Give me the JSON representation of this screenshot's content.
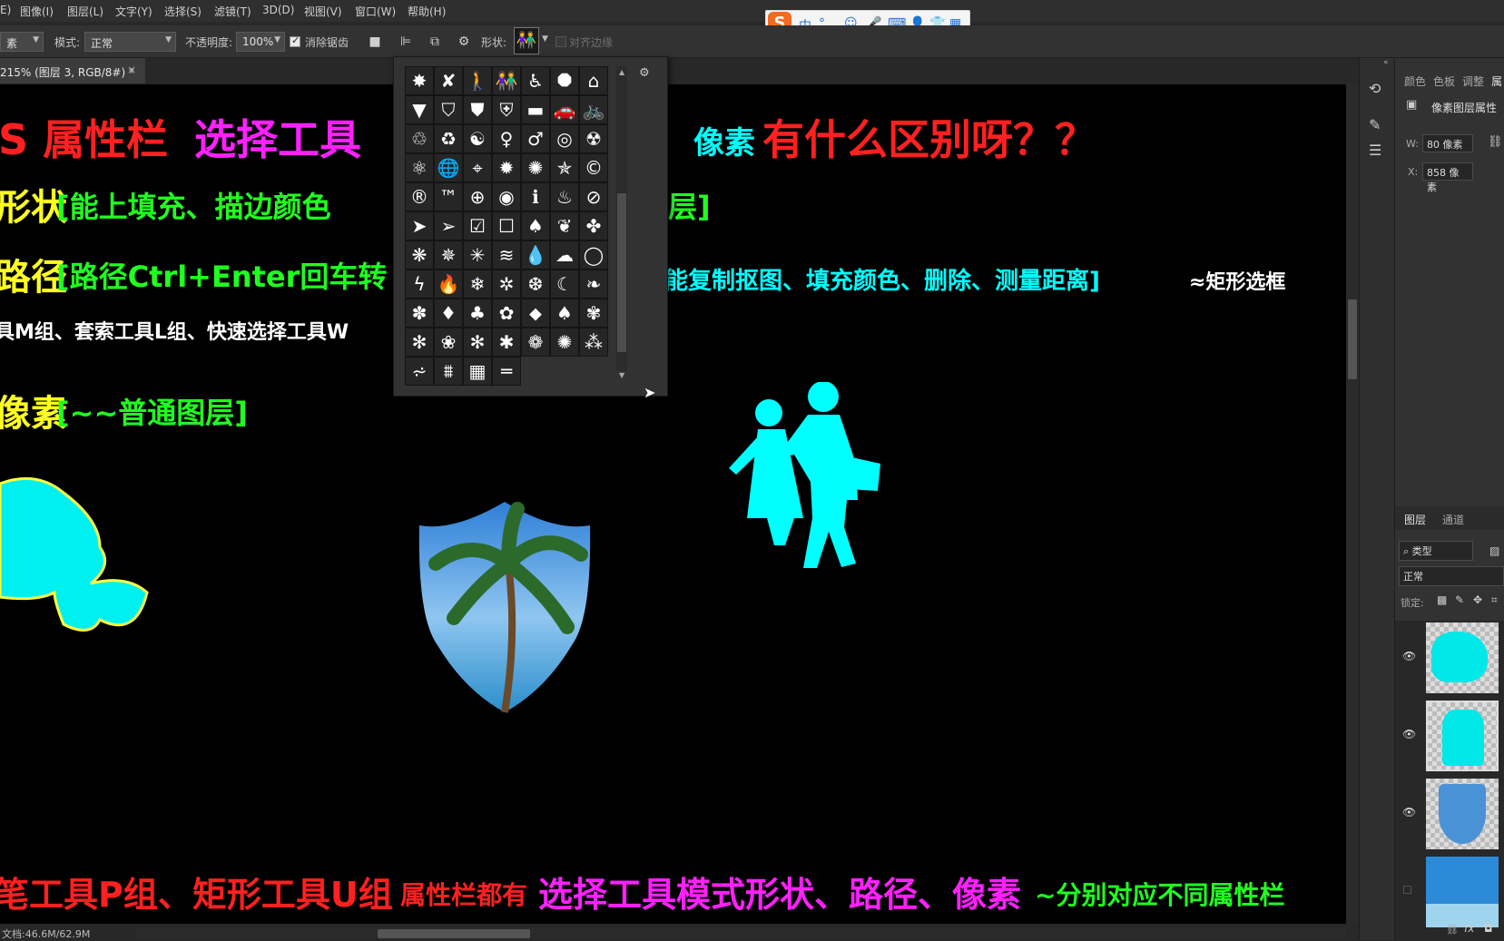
{
  "menu": [
    "E)",
    "图像(I)",
    "图层(L)",
    "文字(Y)",
    "选择(S)",
    "滤镜(T)",
    "3D(D)",
    "视图(V)",
    "窗口(W)",
    "帮助(H)"
  ],
  "ime": {
    "logo": "S",
    "lang": "中",
    "punct": "°,"
  },
  "options": {
    "tool_fragment": "素",
    "mode_label": "模式:",
    "mode_value": "正常",
    "opacity_label": "不透明度:",
    "opacity_value": "100%",
    "antialias_label": "消除锯齿",
    "shape_label": "形状:",
    "align_edges_label": "对齐边缘"
  },
  "tab": {
    "title": "215% (图层 3, RGB/8#) *",
    "close": "×"
  },
  "canvas_text": {
    "line1_a": "S 属性栏",
    "line1_b": "选择工具",
    "line1_c": "像素",
    "line1_d": "有什么区别呀？？",
    "line2_a": "形状",
    "line2_b": "[能上填充、描边颜色",
    "line2_c": "层]",
    "line3_a": "路径",
    "line3_b": "[路径Ctrl+Enter回车转",
    "line3_c": "能复制抠图、填充颜色、删除、测量距离]",
    "line3_d": "≈矩形选框",
    "line4": "具M组、套索工具L组、快速选择工具W",
    "line5_a": "像素",
    "line5_b": "[~~普通图层]",
    "bottom_a": "笔工具P组、矩形工具U组",
    "bottom_b": "属性栏都有",
    "bottom_c": "选择工具模式形状、路径、像素",
    "bottom_d": "~分别对应不同属性栏"
  },
  "shapes": [
    "✸",
    "✘",
    "🚶",
    "👫",
    "♿",
    "⯃",
    "⌂",
    "▼",
    "⛉",
    "⛊",
    "⛨",
    "▬",
    "🚗",
    "🚲",
    "♲",
    "♻",
    "☯",
    "♀",
    "♂",
    "◎",
    "☢",
    "⚛",
    "🌐",
    "⌖",
    "✹",
    "✺",
    "✯",
    "©",
    "®",
    "™",
    "⊕",
    "◉",
    "ℹ",
    "♨",
    "⊘",
    "➤",
    "➢",
    "☑",
    "☐",
    "♠",
    "❦",
    "✤",
    "❋",
    "✵",
    "✳",
    "≋",
    "💧",
    "☁",
    "◯",
    "ϟ",
    "🔥",
    "❄",
    "✲",
    "❆",
    "☾",
    "❧",
    "✽",
    "♦",
    "♣",
    "✿",
    "⬥",
    "♠",
    "✾",
    "✻",
    "❀",
    "✻",
    "✱",
    "❁",
    "✺",
    "⁂",
    "⩫",
    "⩩",
    "▦",
    "═"
  ],
  "right_panel": {
    "tabs_top": [
      "颜色",
      "色板",
      "调整",
      "属"
    ],
    "props_title": "像素图层属性",
    "w_label": "W:",
    "w_value": "80 像素",
    "x_label": "X:",
    "x_value": "858 像素",
    "tabs_layers": [
      "图层",
      "通道"
    ],
    "filter_value": "类型",
    "blend_value": "正常",
    "lock_label": "锁定:",
    "fx_label": "fx"
  },
  "status": {
    "doc": "文档:46.6M/62.9M"
  },
  "colors": {
    "red": "#ff2020",
    "magenta": "#ff20ff",
    "cyan": "#00ffff",
    "green": "#20ff20",
    "yellow": "#ffff20",
    "white": "#ffffff"
  }
}
